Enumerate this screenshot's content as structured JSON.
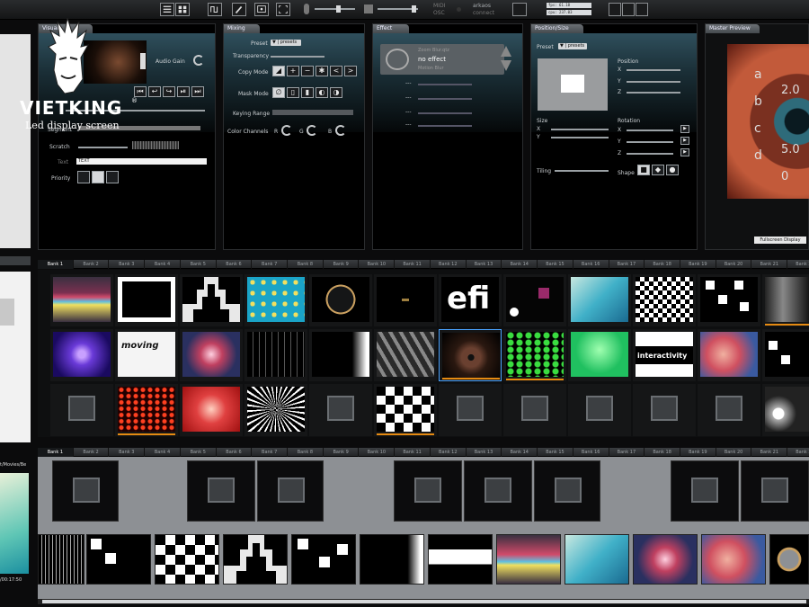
{
  "toolbar": {
    "midi_label": "MIDI",
    "osc_label": "OSC",
    "arkaos_label": "arkaos",
    "connect_label": "connect",
    "fps_label": "fps: 61.18",
    "cpu_label": "cpu: 237.03"
  },
  "visual_panel": {
    "header": "Visual",
    "audio_gain_label": "Audio Gain",
    "segment_label": "Segment",
    "scratch_label": "Scratch",
    "text_label": "Text",
    "text_value": "TEXT",
    "priority_label": "Priority"
  },
  "mixing_panel": {
    "header": "Mixing",
    "preset_label": "Preset",
    "preset_dd": "▼ | presets",
    "transparency_label": "Transparency",
    "copy_mode_label": "Copy Mode",
    "mask_mode_label": "Mask Mode",
    "keying_range_label": "Keying Range",
    "color_channels_label": "Color Channels",
    "channel_r": "R",
    "channel_g": "G",
    "channel_b": "B"
  },
  "effect_panel": {
    "header": "Effect",
    "effect_prev": "Zoom Blur.qtz",
    "effect_current": "no effect",
    "effect_next": "Motion Blur",
    "param_dashes": [
      "---",
      "---",
      "---",
      "---"
    ]
  },
  "position_panel": {
    "header": "Position/Size",
    "preset_label": "Preset",
    "preset_dd": "▼ | presets",
    "position_label": "Position",
    "size_label": "Size",
    "rotation_label": "Rotation",
    "tiling_label": "Tiling",
    "shape_label": "Shape",
    "axis_x": "X",
    "axis_y": "Y",
    "axis_z": "Z"
  },
  "master_preview": {
    "header": "Master Preview",
    "fullscreen_label": "Fullscreen Display",
    "overlay_chars": [
      "a",
      "b",
      "c",
      "d",
      "2.0",
      "5.0",
      "0"
    ]
  },
  "bank_tabs": [
    "Bank 1",
    "Bank 2",
    "Bank 3",
    "Bank 4",
    "Bank 5",
    "Bank 6",
    "Bank 7",
    "Bank 8",
    "Bank 9",
    "Bank 10",
    "Bank 11",
    "Bank 12",
    "Bank 13",
    "Bank 14",
    "Bank 15",
    "Bank 16",
    "Bank 17",
    "Bank 18",
    "Bank 19",
    "Bank 20",
    "Bank 21",
    "Bank 22"
  ],
  "grid_text": {
    "moving_label": "moving",
    "interactivity_label": "interactivity",
    "efi_label": "efi"
  },
  "left_panel": {
    "path_label": "t/Movies/Be",
    "timecode": "/00:17:50"
  },
  "watermark": {
    "brand": "VIETKING",
    "subtitle": "Led display screen",
    "registered": "®"
  },
  "colors": {
    "accent_orange": "#e58a12",
    "panel_glow": "#2f4f5c",
    "flag_blue": "#4aa3ff"
  }
}
